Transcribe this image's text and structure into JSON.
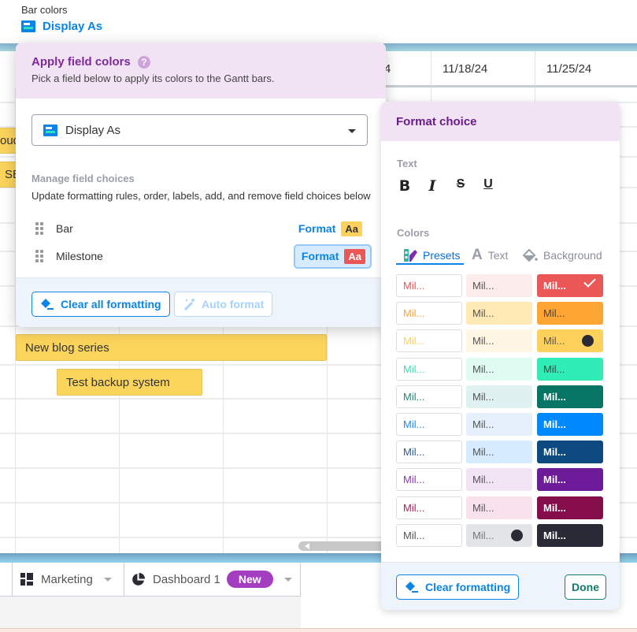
{
  "header": {
    "bar_colors_label": "Bar colors",
    "display_as_link": "Display As"
  },
  "gantt": {
    "date_columns": [
      "4",
      "11/18/24",
      "11/25/24"
    ],
    "partial_bars": [
      "oud",
      "SE"
    ],
    "bars": [
      "New blog series",
      "Test backup system"
    ]
  },
  "tabs": [
    {
      "label": "Marketing",
      "icon": "dashboard-grid-icon"
    },
    {
      "label": "Dashboard 1",
      "icon": "pie-chart-icon",
      "badge": "New"
    }
  ],
  "apply_field_colors": {
    "title": "Apply field colors",
    "help_icon": "?",
    "subtitle": "Pick a field below to apply its colors to the Gantt bars.",
    "field_select_value": "Display As",
    "manage_label": "Manage field choices",
    "manage_desc": "Update formatting rules, order, labels, add, and remove field choices below",
    "choices": [
      {
        "label": "Bar",
        "format_label": "Format",
        "chip": "Aa",
        "chip_bg": "#fdd15c",
        "chip_fg": "#333333",
        "active": false
      },
      {
        "label": "Milestone",
        "format_label": "Format",
        "chip": "Aa",
        "chip_bg": "#eb5757",
        "chip_fg": "#ffffff",
        "active": true
      }
    ],
    "clear_all_label": "Clear all formatting",
    "auto_format_label": "Auto format"
  },
  "format_choice": {
    "title": "Format choice",
    "text_label": "Text",
    "text_styles": [
      {
        "name": "bold",
        "glyph": "B"
      },
      {
        "name": "italic",
        "glyph": "I"
      },
      {
        "name": "strikethrough",
        "glyph": "S"
      },
      {
        "name": "underline",
        "glyph": "U"
      }
    ],
    "colors_label": "Colors",
    "color_tabs": [
      {
        "label": "Presets",
        "active": true
      },
      {
        "label": "Text",
        "active": false
      },
      {
        "label": "Background",
        "active": false
      }
    ],
    "swatch_text": "Mil...",
    "swatch_rows": [
      [
        {
          "bg": "#ffffff",
          "fg": "#eb5757"
        },
        {
          "bg": "#fdecec",
          "fg": "#555555"
        },
        {
          "bg": "#eb5757",
          "fg": "#ffffff",
          "mark": "check"
        }
      ],
      [
        {
          "bg": "#ffffff",
          "fg": "#ffa736"
        },
        {
          "bg": "#ffeab6",
          "fg": "#555555"
        },
        {
          "bg": "#ffa534",
          "fg": "#444444"
        }
      ],
      [
        {
          "bg": "#ffffff",
          "fg": "#fdd15c"
        },
        {
          "bg": "#fff6e3",
          "fg": "#555555"
        },
        {
          "bg": "#fed15c",
          "fg": "#555555",
          "mark": "dot"
        }
      ],
      [
        {
          "bg": "#ffffff",
          "fg": "#38e5b6"
        },
        {
          "bg": "#e0fbf1",
          "fg": "#555555"
        },
        {
          "bg": "#30ecb6",
          "fg": "#444444"
        }
      ],
      [
        {
          "bg": "#ffffff",
          "fg": "#27857a"
        },
        {
          "bg": "#e0f1f2",
          "fg": "#555555"
        },
        {
          "bg": "#067565",
          "fg": "#ffffff"
        }
      ],
      [
        {
          "bg": "#ffffff",
          "fg": "#1a8cf1"
        },
        {
          "bg": "#e5f0fc",
          "fg": "#555555"
        },
        {
          "bg": "#0088ff",
          "fg": "#ffffff"
        }
      ],
      [
        {
          "bg": "#ffffff",
          "fg": "#2b5c8a"
        },
        {
          "bg": "#d6ebfe",
          "fg": "#555555"
        },
        {
          "bg": "#0c4a7f",
          "fg": "#ffffff"
        }
      ],
      [
        {
          "bg": "#ffffff",
          "fg": "#8b3aab"
        },
        {
          "bg": "#f2e4f5",
          "fg": "#555555"
        },
        {
          "bg": "#6e1b99",
          "fg": "#ffffff"
        }
      ],
      [
        {
          "bg": "#ffffff",
          "fg": "#a32060"
        },
        {
          "bg": "#f8e2ec",
          "fg": "#555555"
        },
        {
          "bg": "#860d4c",
          "fg": "#ffffff"
        }
      ],
      [
        {
          "bg": "#ffffff",
          "fg": "#555555"
        },
        {
          "bg": "#e3e4e8",
          "fg": "#777777",
          "mark": "dot"
        },
        {
          "bg": "#292a35",
          "fg": "#ffffff"
        }
      ]
    ],
    "clear_label": "Clear formatting",
    "done_label": "Done"
  }
}
